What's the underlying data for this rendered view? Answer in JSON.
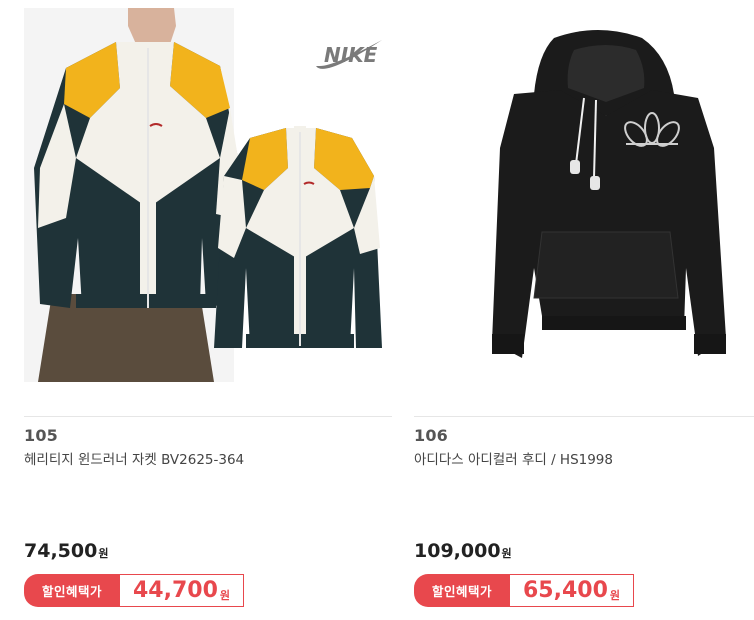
{
  "products": [
    {
      "number": "105",
      "name": "헤리티지 윈드러너 자켓 BV2625-364",
      "price": "74,500",
      "price_unit": "원",
      "discount_tag": "할인혜택가",
      "sale_price": "44,700",
      "sale_unit": "원",
      "brand_logo": "NIKE",
      "image_icon": "windrunner-jacket-image"
    },
    {
      "number": "106",
      "name": "아디다스 아디컬러 후디 / HS1998",
      "price": "109,000",
      "price_unit": "원",
      "discount_tag": "할인혜택가",
      "sale_price": "65,400",
      "sale_unit": "원",
      "image_icon": "black-hoodie-image"
    }
  ],
  "colors": {
    "accent": "#e8484d",
    "jacket_dark": "#1f3338",
    "jacket_yellow": "#f2b31c",
    "hoodie": "#1b1b1b"
  }
}
